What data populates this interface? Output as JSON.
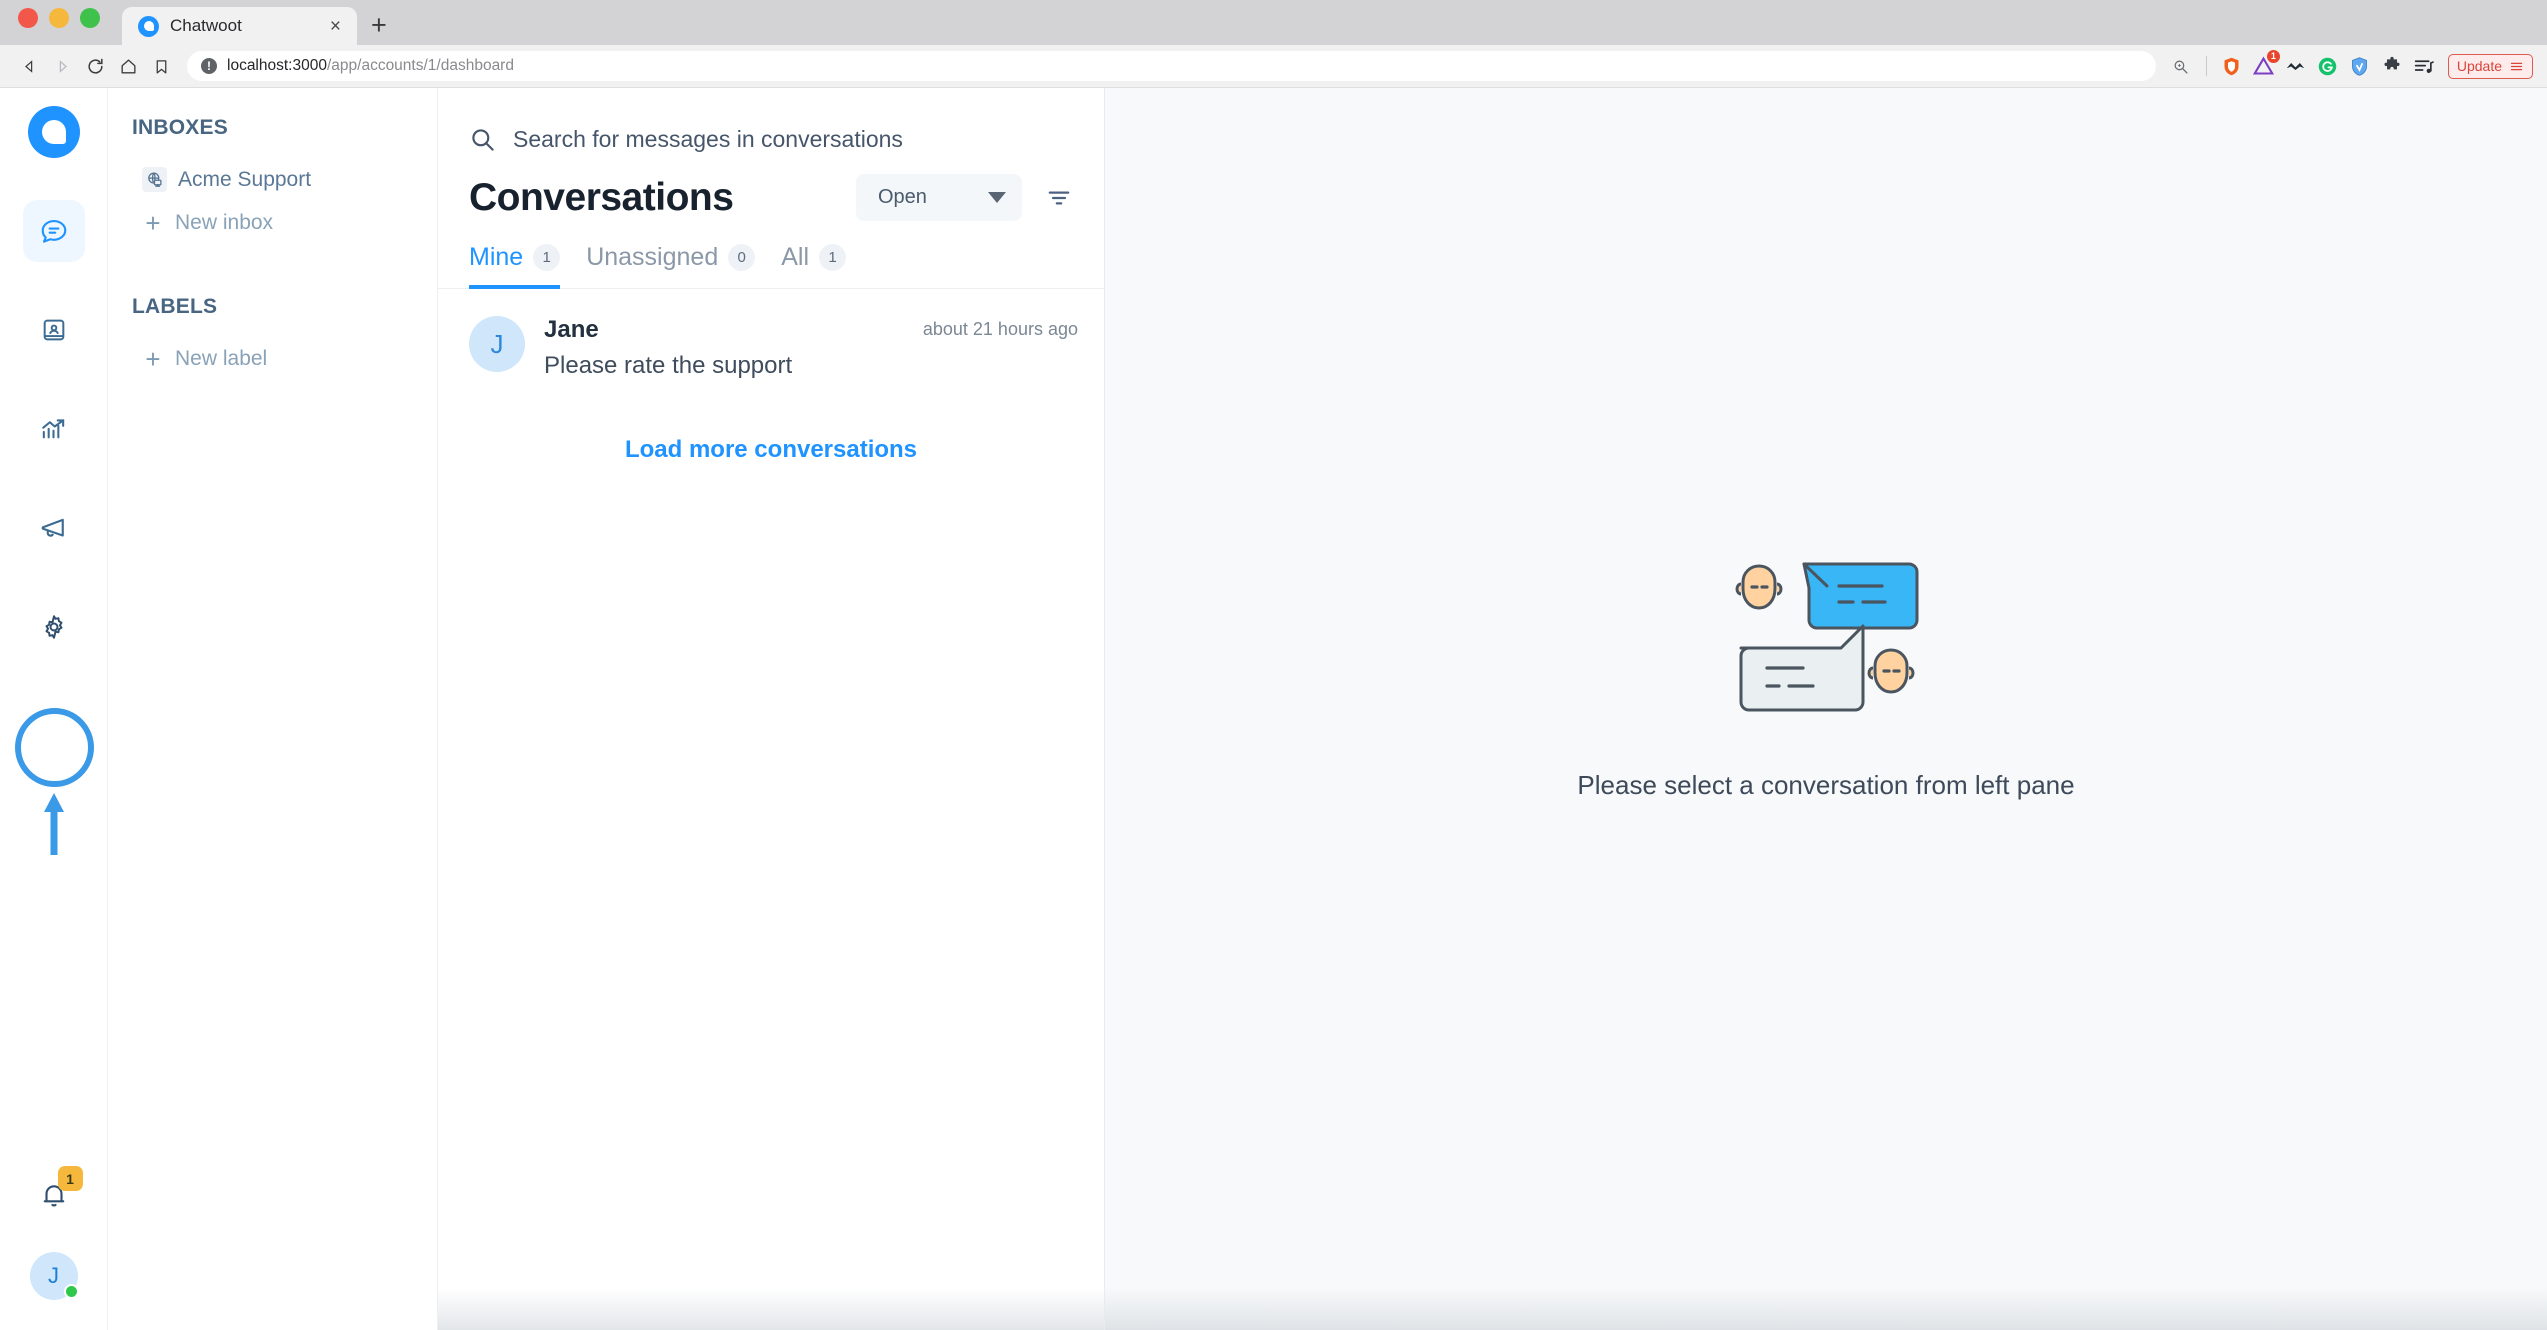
{
  "browser": {
    "tab": {
      "title": "Chatwoot",
      "favicon": "chatwoot-logo-icon",
      "close": "×"
    },
    "new_tab_label": "+",
    "url": {
      "host": "localhost:3000",
      "path": "/app/accounts/1/dashboard",
      "security_icon": "info-circle-icon"
    },
    "nav": {
      "back": "back-icon",
      "forward": "forward-icon",
      "reload": "reload-icon",
      "home": "home-icon",
      "bookmark": "bookmark-icon"
    },
    "extensions": [
      {
        "name": "zoom-icon",
        "badge": ""
      },
      {
        "name": "brave-shield-icon",
        "badge": ""
      },
      {
        "name": "adobe-icon",
        "badge": "1"
      },
      {
        "name": "metamask-icon",
        "badge": ""
      },
      {
        "name": "grammarly-icon",
        "badge": ""
      },
      {
        "name": "vpn-shield-icon",
        "badge": ""
      },
      {
        "name": "puzzle-extensions-icon",
        "badge": ""
      },
      {
        "name": "playlist-icon",
        "badge": ""
      }
    ],
    "update_button": {
      "label": "Update",
      "menu_icon": "hamburger-icon"
    }
  },
  "rail": {
    "brand": "chatwoot-logo",
    "items": [
      {
        "name": "conversations",
        "icon": "chat-bubble-icon",
        "active": true
      },
      {
        "name": "contacts",
        "icon": "contact-book-icon",
        "active": false
      },
      {
        "name": "reports",
        "icon": "analytics-chart-icon",
        "active": false
      },
      {
        "name": "campaigns",
        "icon": "megaphone-icon",
        "active": false
      },
      {
        "name": "settings",
        "icon": "gear-icon",
        "active": false,
        "annotated": true
      }
    ],
    "notifications": {
      "icon": "bell-icon",
      "badge": "1"
    },
    "avatar": {
      "initial": "J",
      "status": "online"
    }
  },
  "sidebar": {
    "sections": [
      {
        "heading": "INBOXES",
        "items": [
          {
            "label": "Acme Support",
            "icon": "website-globe-icon",
            "type": "inbox"
          },
          {
            "label": "New inbox",
            "icon": "plus-icon",
            "type": "action"
          }
        ]
      },
      {
        "heading": "LABELS",
        "items": [
          {
            "label": "New label",
            "icon": "plus-icon",
            "type": "action"
          }
        ]
      }
    ]
  },
  "conversations": {
    "search": {
      "placeholder": "Search for messages in conversations",
      "value": "",
      "icon": "search-icon"
    },
    "title": "Conversations",
    "status_filter": {
      "selected": "Open",
      "icon": "chevron-down-icon"
    },
    "filter_button": "filter-icon",
    "tabs": [
      {
        "label": "Mine",
        "count": "1",
        "active": true
      },
      {
        "label": "Unassigned",
        "count": "0",
        "active": false
      },
      {
        "label": "All",
        "count": "1",
        "active": false
      }
    ],
    "items": [
      {
        "avatar_initial": "J",
        "name": "Jane",
        "message": "Please rate the support",
        "time": "about 21 hours ago"
      }
    ],
    "load_more": "Load more conversations"
  },
  "main": {
    "empty_state": {
      "illustration": "two-people-chatting-illustration",
      "message": "Please select a conversation from left pane"
    }
  },
  "colors": {
    "accent": "#1f93ff",
    "sidebar_text": "#5a7896",
    "illustration_blue": "#38b6f5",
    "illustration_skin": "#ffd2a0",
    "illustration_stroke": "#4a5560",
    "badge_yellow": "#f5b83d",
    "online_green": "#2ec94b",
    "annotation_blue": "#3b9ae8"
  }
}
